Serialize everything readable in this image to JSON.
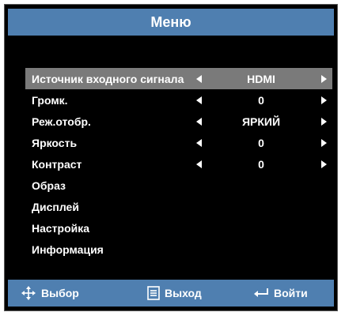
{
  "menu": {
    "title": "Меню",
    "rows": [
      {
        "label": "Источник входного сигнала",
        "value": "HDMI",
        "has_arrows": true,
        "selected": true
      },
      {
        "label": "Громк.",
        "value": "0",
        "has_arrows": true,
        "selected": false
      },
      {
        "label": "Реж.отобр.",
        "value": "ЯРКИЙ",
        "has_arrows": true,
        "selected": false
      },
      {
        "label": "Яркость",
        "value": "0",
        "has_arrows": true,
        "selected": false
      },
      {
        "label": "Контраст",
        "value": "0",
        "has_arrows": true,
        "selected": false
      },
      {
        "label": "Образ",
        "value": "",
        "has_arrows": false,
        "selected": false
      },
      {
        "label": "Дисплей",
        "value": "",
        "has_arrows": false,
        "selected": false
      },
      {
        "label": "Настройка",
        "value": "",
        "has_arrows": false,
        "selected": false
      },
      {
        "label": "Информация",
        "value": "",
        "has_arrows": false,
        "selected": false
      }
    ]
  },
  "footer": {
    "select_label": "Выбор",
    "select_icon": "four-way-arrows-icon",
    "exit_label": "Выход",
    "exit_icon": "menu-box-icon",
    "enter_label": "Войти",
    "enter_icon": "enter-arrow-icon"
  },
  "colors": {
    "background": "#000000",
    "title_bar": "#4f7fb0",
    "selected_row": "#7a7a7a",
    "text": "#ffffff"
  }
}
